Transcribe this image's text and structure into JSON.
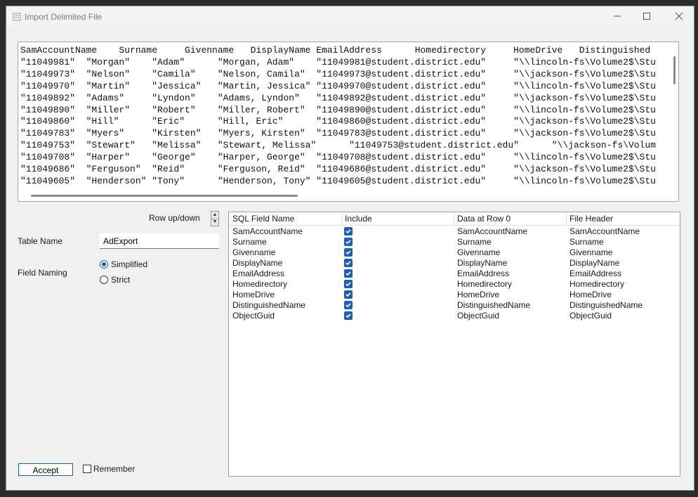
{
  "window": {
    "title": "Import Delimited File"
  },
  "preview": {
    "lines": [
      "SamAccountName    Surname     Givenname   DisplayName EmailAddress      Homedirectory     HomeDrive   Distinguished",
      "\"11049981\"  \"Morgan\"    \"Adam\"      \"Morgan, Adam\"    \"11049981@student.district.edu\"     \"\\\\lincoln-fs\\Volume2$\\Stu",
      "\"11049973\"  \"Nelson\"    \"Camila\"    \"Nelson, Camila\"  \"11049973@student.district.edu\"     \"\\\\jackson-fs\\Volume2$\\Stu",
      "\"11049970\"  \"Martin\"    \"Jessica\"   \"Martin, Jessica\" \"11049970@student.district.edu\"     \"\\\\lincoln-fs\\Volume2$\\Stu",
      "\"11049892\"  \"Adams\"     \"Lyndon\"    \"Adams, Lyndon\"   \"11049892@student.district.edu\"     \"\\\\jackson-fs\\Volume2$\\Stu",
      "\"11049890\"  \"Miller\"    \"Robert\"    \"Miller, Robert\"  \"11049890@student.district.edu\"     \"\\\\lincoln-fs\\Volume2$\\Stu",
      "\"11049860\"  \"Hill\"      \"Eric\"      \"Hill, Eric\"      \"11049860@student.district.edu\"     \"\\\\jackson-fs\\Volume2$\\Stu",
      "\"11049783\"  \"Myers\"     \"Kirsten\"   \"Myers, Kirsten\"  \"11049783@student.district.edu\"     \"\\\\jackson-fs\\Volume2$\\Stu",
      "\"11049753\"  \"Stewart\"   \"Melissa\"   \"Stewart, Melissa\"      \"11049753@student.district.edu\"      \"\\\\jackson-fs\\Volum",
      "\"11049708\"  \"Harper\"    \"George\"    \"Harper, George\"  \"11049708@student.district.edu\"     \"\\\\lincoln-fs\\Volume2$\\Stu",
      "\"11049686\"  \"Ferguson\"  \"Reid\"      \"Ferguson, Reid\"  \"11049686@student.district.edu\"     \"\\\\jackson-fs\\Volume2$\\Stu",
      "\"11049605\"  \"Henderson\" \"Tony\"      \"Henderson, Tony\" \"11049605@student.district.edu\"     \"\\\\lincoln-fs\\Volume2$\\Stu"
    ]
  },
  "controls": {
    "row_updown_label": "Row up/down",
    "table_name_label": "Table Name",
    "table_name_value": "AdExport",
    "field_naming_label": "Field Naming",
    "simplified_label": "Simplified",
    "strict_label": "Strict",
    "field_naming_selected": "Simplified",
    "accept_label": "Accept",
    "remember_label": "Remember",
    "remember_checked": false
  },
  "grid": {
    "headers": [
      "SQL Field Name",
      "Include",
      "Data at Row 0",
      "File Header"
    ],
    "rows": [
      {
        "sql": "SamAccountName",
        "include": true,
        "data": "SamAccountName",
        "header": "SamAccountName"
      },
      {
        "sql": "Surname",
        "include": true,
        "data": "Surname",
        "header": "Surname"
      },
      {
        "sql": "Givenname",
        "include": true,
        "data": "Givenname",
        "header": "Givenname"
      },
      {
        "sql": "DisplayName",
        "include": true,
        "data": "DisplayName",
        "header": "DisplayName"
      },
      {
        "sql": "EmailAddress",
        "include": true,
        "data": "EmailAddress",
        "header": "EmailAddress"
      },
      {
        "sql": "Homedirectory",
        "include": true,
        "data": "Homedirectory",
        "header": "Homedirectory"
      },
      {
        "sql": "HomeDrive",
        "include": true,
        "data": "HomeDrive",
        "header": "HomeDrive"
      },
      {
        "sql": "DistinguishedName",
        "include": true,
        "data": "DistinguishedName",
        "header": "DistinguishedName"
      },
      {
        "sql": "ObjectGuid",
        "include": true,
        "data": "ObjectGuid",
        "header": "ObjectGuid"
      }
    ]
  },
  "colors": {
    "accent": "#1f5fb4"
  },
  "icons": [
    "app-icon",
    "minimize-icon",
    "maximize-icon",
    "close-icon",
    "spin-up-icon",
    "spin-down-icon",
    "checkbox-checked-icon"
  ]
}
